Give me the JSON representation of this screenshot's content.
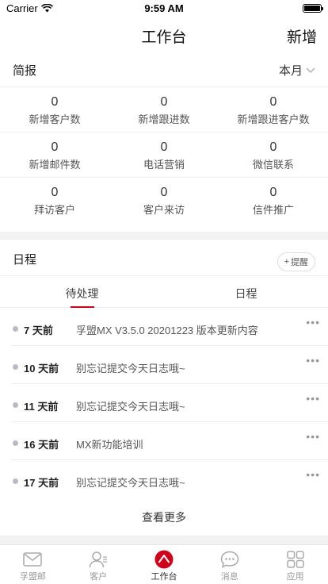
{
  "status_bar": {
    "carrier": "Carrier",
    "time": "9:59 AM"
  },
  "nav": {
    "title": "工作台",
    "action": "新增"
  },
  "summary": {
    "title": "简报",
    "period": "本月",
    "stats": [
      {
        "value": "0",
        "label": "新增客户数"
      },
      {
        "value": "0",
        "label": "新增跟进数"
      },
      {
        "value": "0",
        "label": "新增跟进客户数"
      },
      {
        "value": "0",
        "label": "新增邮件数"
      },
      {
        "value": "0",
        "label": "电话营销"
      },
      {
        "value": "0",
        "label": "微信联系"
      },
      {
        "value": "0",
        "label": "拜访客户"
      },
      {
        "value": "0",
        "label": "客户来访"
      },
      {
        "value": "0",
        "label": "信件推广"
      }
    ]
  },
  "schedule": {
    "title": "日程",
    "remind_label": "提醒",
    "tabs": [
      {
        "label": "待处理"
      },
      {
        "label": "日程"
      }
    ],
    "items": [
      {
        "when": "7 天前",
        "content": "孚盟MX V3.5.0 20201223 版本更新内容"
      },
      {
        "when": "10 天前",
        "content": "别忘记提交今天日志哦~"
      },
      {
        "when": "11 天前",
        "content": "别忘记提交今天日志哦~"
      },
      {
        "when": "16 天前",
        "content": "MX新功能培训"
      },
      {
        "when": "17 天前",
        "content": "别忘记提交今天日志哦~"
      }
    ],
    "see_more": "查看更多"
  },
  "tab_bar": {
    "items": [
      {
        "label": "孚盟邮",
        "icon": "mail-icon"
      },
      {
        "label": "客户",
        "icon": "contacts-icon"
      },
      {
        "label": "工作台",
        "icon": "workbench-icon"
      },
      {
        "label": "消息",
        "icon": "chat-icon"
      },
      {
        "label": "应用",
        "icon": "apps-grid-icon"
      }
    ]
  },
  "colors": {
    "accent": "#d0021b",
    "dot": "#b8bac5"
  }
}
